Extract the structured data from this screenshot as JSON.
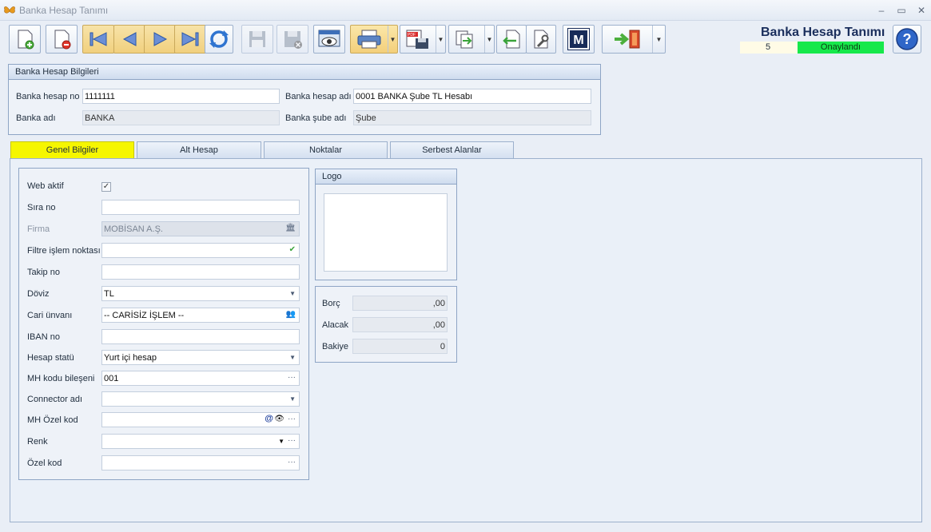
{
  "window": {
    "title": "Banka Hesap Tanımı",
    "minimize": "–",
    "restore": "▭",
    "close": "✕"
  },
  "header": {
    "title": "Banka Hesap Tanımı",
    "number": "5",
    "status": "Onaylandı",
    "status_color": "#17e84b"
  },
  "toolbar": {
    "buttons": [
      "new-icon",
      "delete-icon",
      "first-icon",
      "prev-icon",
      "next-icon",
      "last-icon",
      "refresh-icon",
      "save-icon",
      "save-close-icon",
      "preview-icon",
      "print-icon",
      "pdf-export-icon",
      "copy-icon",
      "import-icon",
      "tools-icon",
      "m-icon",
      "exit-icon",
      "help-icon"
    ],
    "m_label": "M"
  },
  "bank_info": {
    "title": "Banka Hesap Bilgileri",
    "account_no_label": "Banka hesap no",
    "account_no": "1111111",
    "account_name_label": "Banka hesap adı",
    "account_name": "0001 BANKA Şube TL Hesabı",
    "bank_name_label": "Banka adı",
    "bank_name": "BANKA",
    "branch_name_label": "Banka şube adı",
    "branch_name": "Şube"
  },
  "tabs": [
    {
      "label": "Genel Bilgiler",
      "active": true
    },
    {
      "label": "Alt Hesap",
      "active": false
    },
    {
      "label": "Noktalar",
      "active": false
    },
    {
      "label": "Serbest Alanlar",
      "active": false
    }
  ],
  "general": {
    "web_active_label": "Web aktif",
    "web_active_checked": "✓",
    "sira_no_label": "Sıra no",
    "sira_no": "",
    "firma_label": "Firma",
    "firma": "MOBİSAN A.Ş.",
    "filtre_label": "Filtre işlem noktası",
    "filtre": "",
    "takip_label": "Takip no",
    "takip": "",
    "doviz_label": "Döviz",
    "doviz": "TL",
    "cari_label": "Cari ünvanı",
    "cari": "-- CARİSİZ İŞLEM --",
    "iban_label": "IBAN no",
    "iban": "",
    "hesap_statu_label": "Hesap statü",
    "hesap_statu": "Yurt içi hesap",
    "mh_kodu_label": "MH kodu bileşeni",
    "mh_kodu": "001",
    "connector_label": "Connector adı",
    "connector": "",
    "mh_ozel_label": "MH Özel kod",
    "mh_ozel": "",
    "renk_label": "Renk",
    "renk": "",
    "ozel_label": "Özel kod",
    "ozel": ""
  },
  "logo": {
    "title": "Logo"
  },
  "balance": {
    "borc_label": "Borç",
    "borc": ",00",
    "alacak_label": "Alacak",
    "alacak": ",00",
    "bakiye_label": "Bakiye",
    "bakiye": "0"
  }
}
